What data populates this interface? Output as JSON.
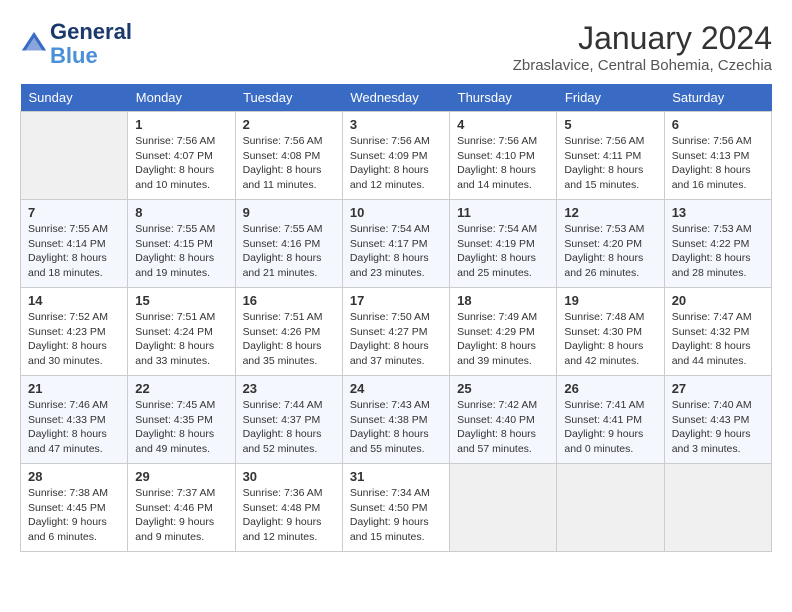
{
  "header": {
    "logo_line1": "General",
    "logo_line2": "Blue",
    "month_year": "January 2024",
    "location": "Zbraslavice, Central Bohemia, Czechia"
  },
  "days_of_week": [
    "Sunday",
    "Monday",
    "Tuesday",
    "Wednesday",
    "Thursday",
    "Friday",
    "Saturday"
  ],
  "weeks": [
    [
      {
        "day": "",
        "info": ""
      },
      {
        "day": "1",
        "info": "Sunrise: 7:56 AM\nSunset: 4:07 PM\nDaylight: 8 hours\nand 10 minutes."
      },
      {
        "day": "2",
        "info": "Sunrise: 7:56 AM\nSunset: 4:08 PM\nDaylight: 8 hours\nand 11 minutes."
      },
      {
        "day": "3",
        "info": "Sunrise: 7:56 AM\nSunset: 4:09 PM\nDaylight: 8 hours\nand 12 minutes."
      },
      {
        "day": "4",
        "info": "Sunrise: 7:56 AM\nSunset: 4:10 PM\nDaylight: 8 hours\nand 14 minutes."
      },
      {
        "day": "5",
        "info": "Sunrise: 7:56 AM\nSunset: 4:11 PM\nDaylight: 8 hours\nand 15 minutes."
      },
      {
        "day": "6",
        "info": "Sunrise: 7:56 AM\nSunset: 4:13 PM\nDaylight: 8 hours\nand 16 minutes."
      }
    ],
    [
      {
        "day": "7",
        "info": "Sunrise: 7:55 AM\nSunset: 4:14 PM\nDaylight: 8 hours\nand 18 minutes."
      },
      {
        "day": "8",
        "info": "Sunrise: 7:55 AM\nSunset: 4:15 PM\nDaylight: 8 hours\nand 19 minutes."
      },
      {
        "day": "9",
        "info": "Sunrise: 7:55 AM\nSunset: 4:16 PM\nDaylight: 8 hours\nand 21 minutes."
      },
      {
        "day": "10",
        "info": "Sunrise: 7:54 AM\nSunset: 4:17 PM\nDaylight: 8 hours\nand 23 minutes."
      },
      {
        "day": "11",
        "info": "Sunrise: 7:54 AM\nSunset: 4:19 PM\nDaylight: 8 hours\nand 25 minutes."
      },
      {
        "day": "12",
        "info": "Sunrise: 7:53 AM\nSunset: 4:20 PM\nDaylight: 8 hours\nand 26 minutes."
      },
      {
        "day": "13",
        "info": "Sunrise: 7:53 AM\nSunset: 4:22 PM\nDaylight: 8 hours\nand 28 minutes."
      }
    ],
    [
      {
        "day": "14",
        "info": "Sunrise: 7:52 AM\nSunset: 4:23 PM\nDaylight: 8 hours\nand 30 minutes."
      },
      {
        "day": "15",
        "info": "Sunrise: 7:51 AM\nSunset: 4:24 PM\nDaylight: 8 hours\nand 33 minutes."
      },
      {
        "day": "16",
        "info": "Sunrise: 7:51 AM\nSunset: 4:26 PM\nDaylight: 8 hours\nand 35 minutes."
      },
      {
        "day": "17",
        "info": "Sunrise: 7:50 AM\nSunset: 4:27 PM\nDaylight: 8 hours\nand 37 minutes."
      },
      {
        "day": "18",
        "info": "Sunrise: 7:49 AM\nSunset: 4:29 PM\nDaylight: 8 hours\nand 39 minutes."
      },
      {
        "day": "19",
        "info": "Sunrise: 7:48 AM\nSunset: 4:30 PM\nDaylight: 8 hours\nand 42 minutes."
      },
      {
        "day": "20",
        "info": "Sunrise: 7:47 AM\nSunset: 4:32 PM\nDaylight: 8 hours\nand 44 minutes."
      }
    ],
    [
      {
        "day": "21",
        "info": "Sunrise: 7:46 AM\nSunset: 4:33 PM\nDaylight: 8 hours\nand 47 minutes."
      },
      {
        "day": "22",
        "info": "Sunrise: 7:45 AM\nSunset: 4:35 PM\nDaylight: 8 hours\nand 49 minutes."
      },
      {
        "day": "23",
        "info": "Sunrise: 7:44 AM\nSunset: 4:37 PM\nDaylight: 8 hours\nand 52 minutes."
      },
      {
        "day": "24",
        "info": "Sunrise: 7:43 AM\nSunset: 4:38 PM\nDaylight: 8 hours\nand 55 minutes."
      },
      {
        "day": "25",
        "info": "Sunrise: 7:42 AM\nSunset: 4:40 PM\nDaylight: 8 hours\nand 57 minutes."
      },
      {
        "day": "26",
        "info": "Sunrise: 7:41 AM\nSunset: 4:41 PM\nDaylight: 9 hours\nand 0 minutes."
      },
      {
        "day": "27",
        "info": "Sunrise: 7:40 AM\nSunset: 4:43 PM\nDaylight: 9 hours\nand 3 minutes."
      }
    ],
    [
      {
        "day": "28",
        "info": "Sunrise: 7:38 AM\nSunset: 4:45 PM\nDaylight: 9 hours\nand 6 minutes."
      },
      {
        "day": "29",
        "info": "Sunrise: 7:37 AM\nSunset: 4:46 PM\nDaylight: 9 hours\nand 9 minutes."
      },
      {
        "day": "30",
        "info": "Sunrise: 7:36 AM\nSunset: 4:48 PM\nDaylight: 9 hours\nand 12 minutes."
      },
      {
        "day": "31",
        "info": "Sunrise: 7:34 AM\nSunset: 4:50 PM\nDaylight: 9 hours\nand 15 minutes."
      },
      {
        "day": "",
        "info": ""
      },
      {
        "day": "",
        "info": ""
      },
      {
        "day": "",
        "info": ""
      }
    ]
  ]
}
